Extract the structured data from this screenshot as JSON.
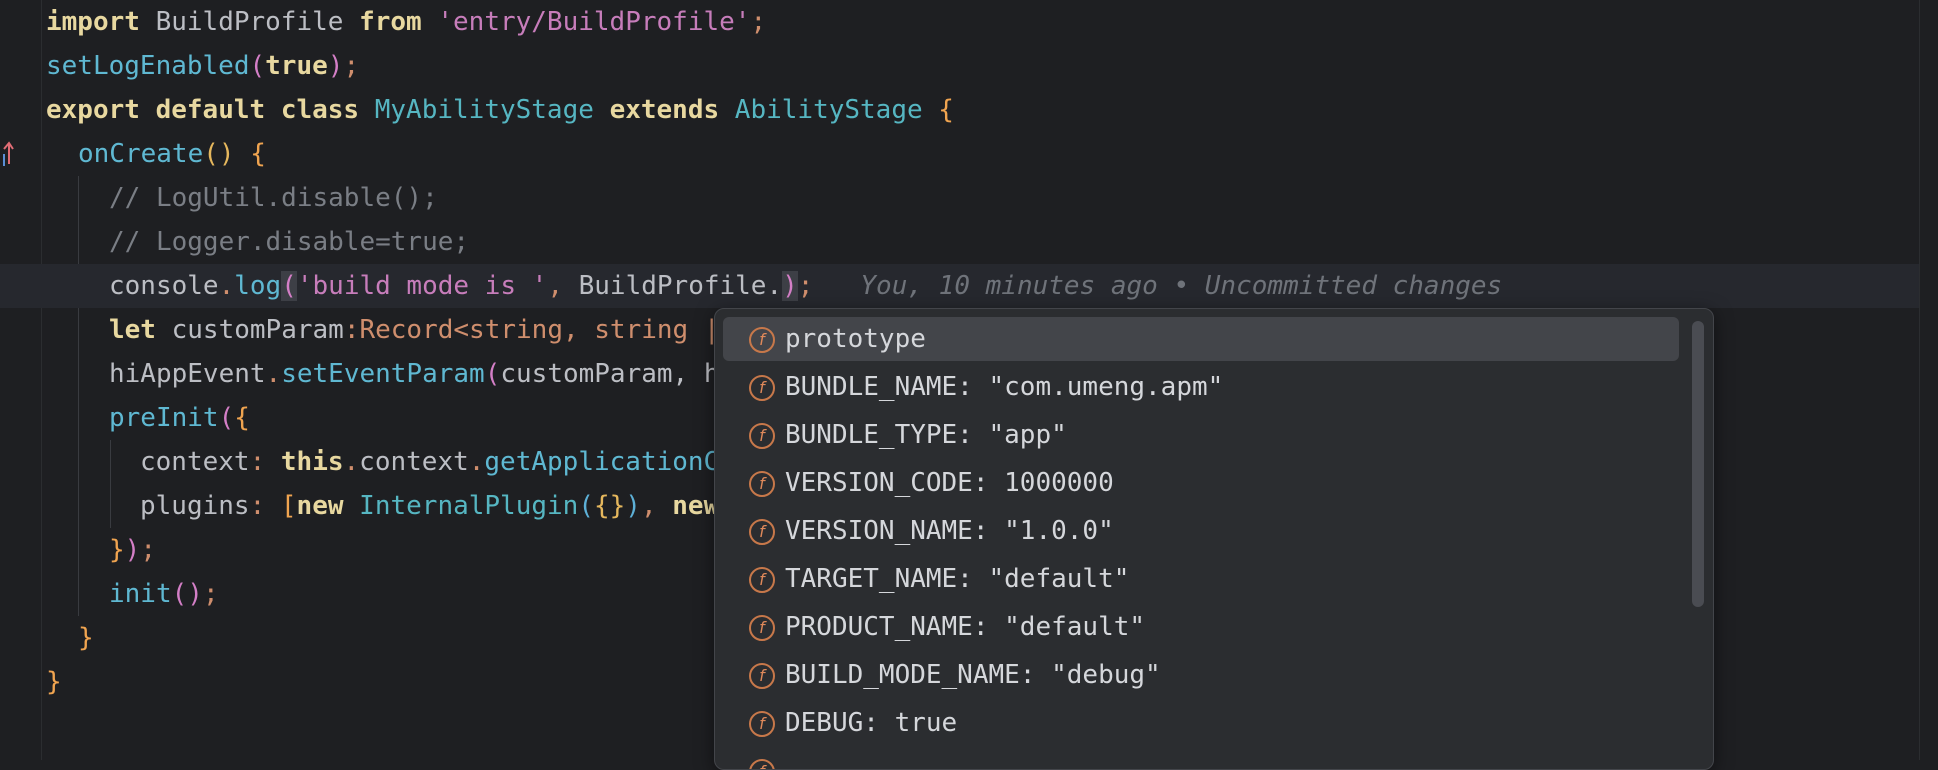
{
  "code": {
    "line1": {
      "kw_import": "import",
      "name": "BuildProfile",
      "kw_from": "from",
      "path": "'entry/BuildProfile'",
      "end": ";"
    },
    "line2": {
      "fn": "setLogEnabled",
      "open": "(",
      "arg": "true",
      "close": ")",
      "end": ";"
    },
    "line3": {
      "kw_export": "export",
      "kw_default": "default",
      "kw_class": "class",
      "name": "MyAbilityStage",
      "kw_extends": "extends",
      "base": "AbilityStage",
      "brace": "{"
    },
    "line4": {
      "fn": "onCreate",
      "parens": "()",
      "brace": "{"
    },
    "line5": {
      "comment": "// LogUtil.disable();"
    },
    "line6": {
      "comment": "// Logger.disable=true;"
    },
    "line7": {
      "obj": "console",
      "dot": ".",
      "fn": "log",
      "open": "(",
      "str": "'build mode is '",
      "comma": ", ",
      "ref": "BuildProfile.",
      "close": ")",
      "end": ";",
      "blame": "You, 10 minutes ago • Uncommitted changes"
    },
    "line8": {
      "kw_let": "let",
      "name": "customParam",
      "colon": ":",
      "type": "Record",
      "lt": "<",
      "t1": "string",
      "comma": ", ",
      "t2": "string",
      "tail": " |"
    },
    "line9": {
      "obj": "hiAppEvent",
      "dot": ".",
      "fn": "setEventParam",
      "open": "(",
      "arg": "customParam",
      "tail": ", h"
    },
    "line10": {
      "fn": "preInit",
      "open": "(",
      "brace": "{"
    },
    "line11": {
      "key": "context",
      "colon": ": ",
      "kw_this": "this",
      "dot": ".",
      "prop": "context",
      "dot2": ".",
      "fn": "getApplicationC"
    },
    "line12": {
      "key": "plugins",
      "colon": ": ",
      "bracket": "[",
      "kw_new": "new",
      "cls": "InternalPlugin",
      "open": "(",
      "obj": "{}",
      "close": ")",
      "tail_comma": ", ",
      "kw_new2": "new"
    },
    "line13": {
      "brace": "}",
      "paren": ")",
      "end": ";"
    },
    "line14": {
      "fn": "init",
      "parens": "()",
      "end": ";"
    },
    "line15": {
      "brace": "}"
    },
    "line16": {
      "brace": "}"
    }
  },
  "completion": {
    "icon_letter": "f",
    "items": [
      {
        "label": "prototype"
      },
      {
        "label": "BUNDLE_NAME: \"com.umeng.apm\""
      },
      {
        "label": "BUNDLE_TYPE: \"app\""
      },
      {
        "label": "VERSION_CODE: 1000000"
      },
      {
        "label": "VERSION_NAME: \"1.0.0\""
      },
      {
        "label": "TARGET_NAME: \"default\""
      },
      {
        "label": "PRODUCT_NAME: \"default\""
      },
      {
        "label": "BUILD_MODE_NAME: \"debug\""
      },
      {
        "label": "DEBUG: true"
      }
    ],
    "selected_index": 0
  },
  "colors": {
    "background": "#1e1f22",
    "popup_background": "#2b2d30",
    "selection": "#43454a",
    "icon_orange": "#e0895a"
  }
}
